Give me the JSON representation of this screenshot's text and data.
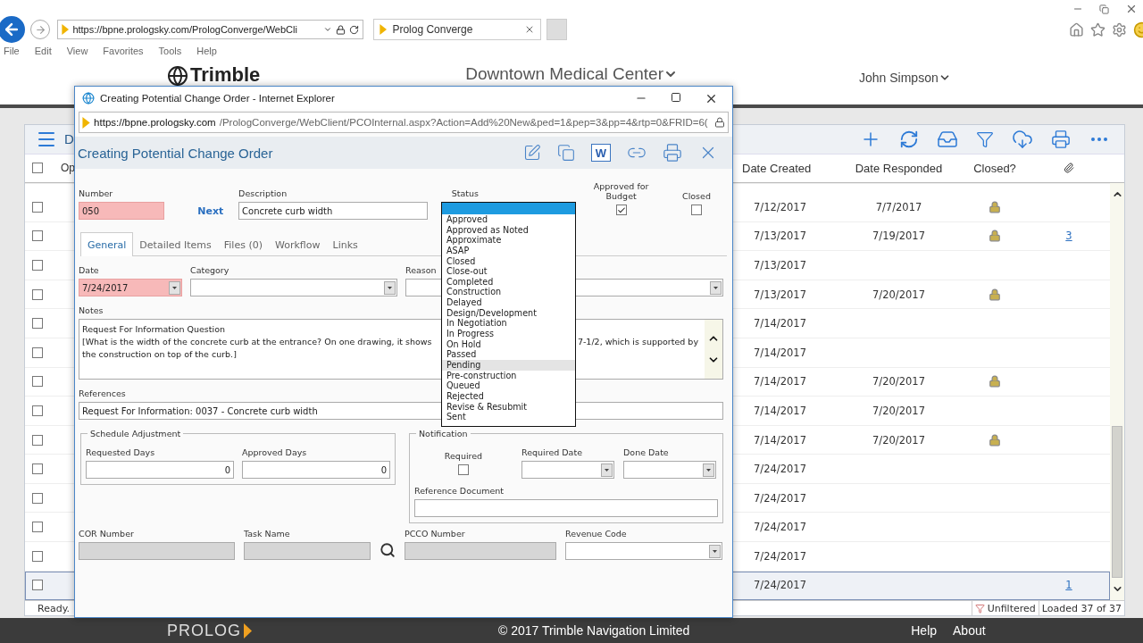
{
  "browser": {
    "address": "https://bpne.prologsky.com/PrologConverge/WebCli",
    "tabs": [
      {
        "label": "Prolog Converge",
        "selected": true
      }
    ],
    "menu": [
      "File",
      "Edit",
      "View",
      "Favorites",
      "Tools",
      "Help"
    ]
  },
  "app_header": {
    "logo": "Trimble",
    "project": "Downtown Medical Center",
    "user": "John Simpson"
  },
  "grid": {
    "title": "D",
    "header_checked": false,
    "columns": [
      "Op",
      "Date Created",
      "Date Responded",
      "Closed?"
    ],
    "rows": [
      {
        "date_created": "7/12/2017",
        "date_responded": "7/7/2017",
        "closed": true,
        "checked": false,
        "selected": false
      },
      {
        "date_created": "7/13/2017",
        "date_responded": "7/19/2017",
        "closed": true,
        "attachments": "3",
        "checked": false,
        "selected": false
      },
      {
        "date_created": "7/13/2017",
        "closed": false,
        "checked": false,
        "selected": false
      },
      {
        "date_created": "7/13/2017",
        "date_responded": "7/20/2017",
        "closed": true,
        "checked": false,
        "selected": false
      },
      {
        "date_created": "7/14/2017",
        "closed": false,
        "checked": false,
        "selected": false
      },
      {
        "date_created": "7/14/2017",
        "closed": false,
        "checked": false,
        "selected": false
      },
      {
        "date_created": "7/14/2017",
        "date_responded": "7/20/2017",
        "closed": true,
        "checked": false,
        "selected": false
      },
      {
        "date_created": "7/14/2017",
        "date_responded": "7/20/2017",
        "closed": false,
        "checked": false,
        "selected": false
      },
      {
        "date_created": "7/14/2017",
        "date_responded": "7/20/2017",
        "closed": true,
        "checked": false,
        "selected": false
      },
      {
        "date_created": "7/24/2017",
        "closed": false,
        "checked": false,
        "selected": false
      },
      {
        "date_created": "7/24/2017",
        "closed": false,
        "checked": false,
        "selected": false
      },
      {
        "date_created": "7/24/2017",
        "closed": false,
        "checked": false,
        "selected": false
      },
      {
        "date_created": "7/24/2017",
        "closed": false,
        "checked": false,
        "selected": false
      },
      {
        "date_created": "7/24/2017",
        "closed": false,
        "attachments": "1",
        "checked": false,
        "selected": true
      }
    ]
  },
  "status_bar": {
    "left": "Ready.",
    "filter": "Unfiltered",
    "loaded": "Loaded 37 of 37"
  },
  "footer": {
    "brand": "PROLOG",
    "copyright": "© 2017 Trimble Navigation Limited",
    "links": [
      "Help",
      "About"
    ]
  },
  "dialog": {
    "window_title": "Creating Potential Change Order - Internet Explorer",
    "address_host": "https://bpne.prologsky.com",
    "address_path": "/PrologConverge/WebClient/PCOInternal.aspx?Action=Add%20New&ped=1&pep=3&pp=4&rtp=0&FRID=6(",
    "heading": "Creating Potential Change Order",
    "word_button": "W",
    "number": {
      "label": "Number",
      "value": "050",
      "required": true
    },
    "next_link": "Next",
    "description": {
      "label": "Description",
      "value": "Concrete curb width",
      "required": false
    },
    "status": {
      "label": "Status",
      "empty_option_selected": true,
      "options": [
        {
          "label": "Approved",
          "hovered": false
        },
        {
          "label": "Approved as Noted",
          "hovered": false
        },
        {
          "label": "Approximate",
          "hovered": false
        },
        {
          "label": "ASAP",
          "hovered": false
        },
        {
          "label": "Closed",
          "hovered": false
        },
        {
          "label": "Close-out",
          "hovered": false
        },
        {
          "label": "Completed",
          "hovered": false
        },
        {
          "label": "Construction",
          "hovered": false
        },
        {
          "label": "Delayed",
          "hovered": false
        },
        {
          "label": "Design/Development",
          "hovered": false
        },
        {
          "label": "In Negotiation",
          "hovered": false
        },
        {
          "label": "In Progress",
          "hovered": false
        },
        {
          "label": "On Hold",
          "hovered": false
        },
        {
          "label": "Passed",
          "hovered": false
        },
        {
          "label": "Pending",
          "hovered": true
        },
        {
          "label": "Pre-construction",
          "hovered": false
        },
        {
          "label": "Queued",
          "hovered": false
        },
        {
          "label": "Rejected",
          "hovered": false
        },
        {
          "label": "Revise & Resubmit",
          "hovered": false
        },
        {
          "label": "Sent",
          "hovered": false
        }
      ]
    },
    "approved_for_budget": {
      "label": "Approved for Budget",
      "checked": true
    },
    "closed": {
      "label": "Closed",
      "checked": false
    },
    "tabs": [
      {
        "label": "General",
        "selected": true
      },
      {
        "label": "Detailed Items",
        "selected": false
      },
      {
        "label": "Files (0)",
        "selected": false
      },
      {
        "label": "Workflow",
        "selected": false
      },
      {
        "label": "Links",
        "selected": false
      }
    ],
    "date": {
      "label": "Date",
      "value": "7/24/2017",
      "required": true
    },
    "category": {
      "label": "Category"
    },
    "reason": {
      "label": "Reason"
    },
    "notes": {
      "label": "Notes",
      "line_1": "Request For Information Question",
      "line_2_start": "[What is the width of the concrete curb at the entrance?  On one drawing, it shows",
      "line_2_end": "7-1/2, which is supported by",
      "line_3": "the construction on top of the curb.]"
    },
    "references": {
      "label": "References",
      "value": "Request For Information: 0037 - Concrete curb width"
    },
    "schedule": {
      "legend": "Schedule Adjustment",
      "fields": [
        {
          "label": "Requested Days",
          "value": "0"
        },
        {
          "label": "Approved Days",
          "value": "0"
        }
      ]
    },
    "notification": {
      "legend": "Notification",
      "required": {
        "label": "Required",
        "checked": false
      },
      "dates": [
        {
          "label": "Required Date"
        },
        {
          "label": "Done Date"
        }
      ],
      "reference_document": {
        "label": "Reference Document"
      }
    },
    "bottom_fields": [
      {
        "label": "COR Number",
        "kind": "disabled"
      },
      {
        "label": "Task Name",
        "kind": "lookup"
      },
      {
        "label": "PCCO Number",
        "kind": "disabled"
      },
      {
        "label": "Revenue Code",
        "kind": "select"
      }
    ]
  }
}
